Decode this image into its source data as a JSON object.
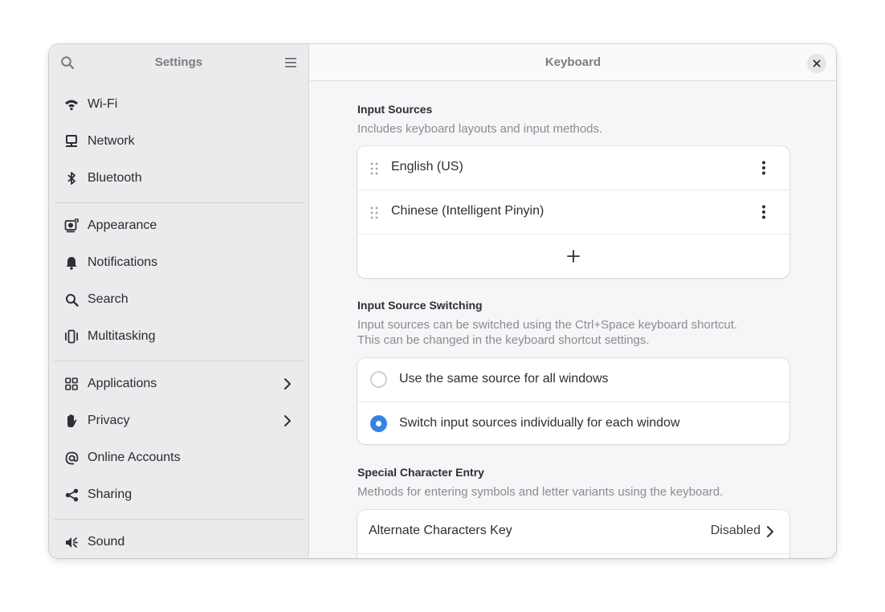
{
  "sidebar": {
    "title": "Settings",
    "groups": [
      [
        {
          "label": "Wi-Fi",
          "icon": "wifi-icon"
        },
        {
          "label": "Network",
          "icon": "network-icon"
        },
        {
          "label": "Bluetooth",
          "icon": "bluetooth-icon"
        }
      ],
      [
        {
          "label": "Appearance",
          "icon": "appearance-icon"
        },
        {
          "label": "Notifications",
          "icon": "bell-icon"
        },
        {
          "label": "Search",
          "icon": "search-icon"
        },
        {
          "label": "Multitasking",
          "icon": "multitasking-icon"
        }
      ],
      [
        {
          "label": "Applications",
          "icon": "applications-icon",
          "chevron": true
        },
        {
          "label": "Privacy",
          "icon": "hand-icon",
          "chevron": true
        },
        {
          "label": "Online Accounts",
          "icon": "at-icon"
        },
        {
          "label": "Sharing",
          "icon": "share-icon"
        }
      ],
      [
        {
          "label": "Sound",
          "icon": "sound-icon"
        }
      ]
    ]
  },
  "main": {
    "title": "Keyboard",
    "input_sources": {
      "title": "Input Sources",
      "description": "Includes keyboard layouts and input methods.",
      "items": [
        "English (US)",
        "Chinese (Intelligent Pinyin)"
      ]
    },
    "switching": {
      "title": "Input Source Switching",
      "description_line1": "Input sources can be switched using the Ctrl+Space keyboard shortcut.",
      "description_line2": "This can be changed in the keyboard shortcut settings.",
      "options": [
        {
          "label": "Use the same source for all windows",
          "selected": false
        },
        {
          "label": "Switch input sources individually for each window",
          "selected": true
        }
      ]
    },
    "special": {
      "title": "Special Character Entry",
      "description": "Methods for entering symbols and letter variants using the keyboard.",
      "alternate_label": "Alternate Characters Key",
      "alternate_value": "Disabled"
    }
  },
  "colors": {
    "accent": "#3584e4",
    "sidebar_bg": "#ebebed",
    "window_bg": "#fafafb"
  }
}
